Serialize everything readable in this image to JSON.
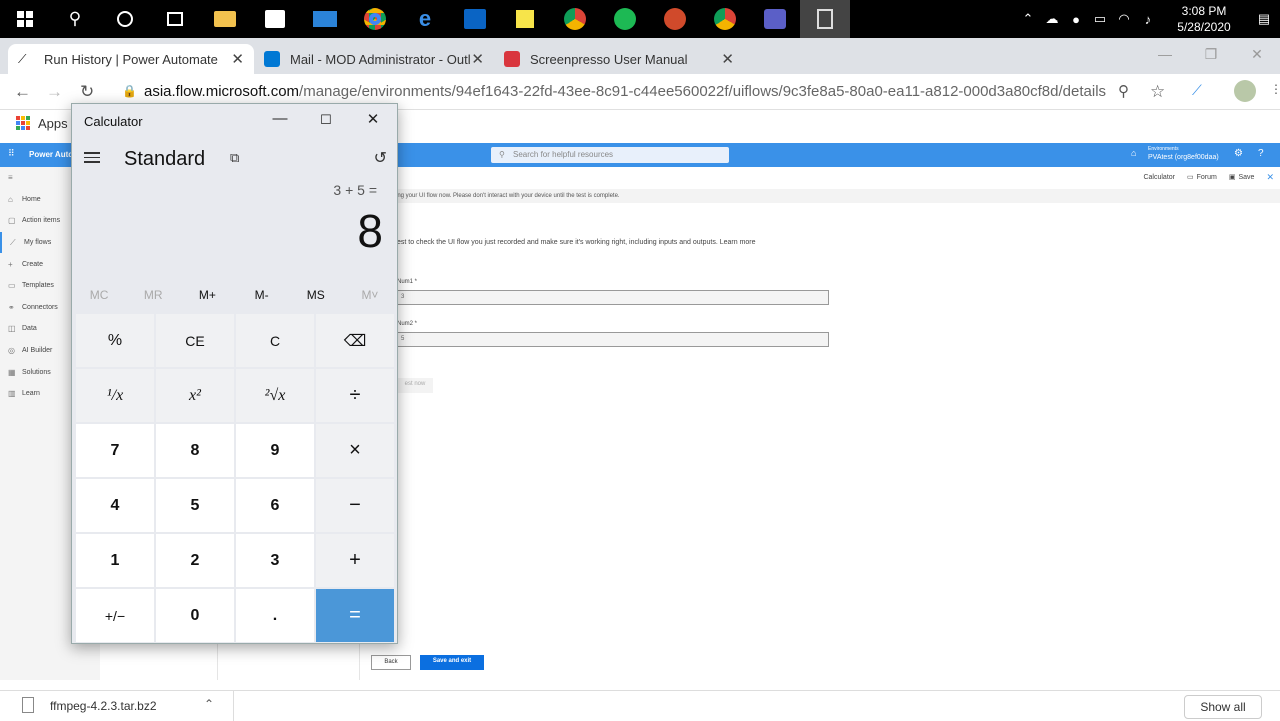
{
  "taskbar": {
    "icons": [
      "windows-start-icon",
      "search-icon",
      "cortana-icon",
      "task-view-icon",
      "file-explorer-icon",
      "store-icon",
      "mail-icon",
      "chrome-icon",
      "edge-icon",
      "outlook-icon",
      "sticky-notes-icon",
      "chrome-profile-icon",
      "spotify-icon",
      "powerpoint-icon",
      "chrome-alt-icon",
      "teams-icon",
      "calculator-icon"
    ],
    "time": "3:08 PM",
    "date": "5/28/2020"
  },
  "browser": {
    "tabs": [
      {
        "label": "Run History | Power Automate",
        "color": "#ffffff"
      },
      {
        "label": "Mail - MOD Administrator - Outl",
        "color": "#0078d4"
      },
      {
        "label": "Screenpresso User Manual",
        "color": "#d9363e"
      }
    ],
    "new_tab": "+",
    "url_host": "asia.flow.microsoft.com",
    "url_path": "/manage/environments/94ef1643-22fd-43ee-8c91-c44ee560022f/uiflows/9c3fe8a5-80a0-ea11-a812-000d3a80cf8d/details",
    "bookmarks_apps": "Apps"
  },
  "power_automate": {
    "brand": "Power Auto",
    "search_placeholder": "Search for helpful resources",
    "env_label": "Environments",
    "env_name": "PVAtest (org8ef00daa)",
    "nav": [
      "Home",
      "Action items",
      "My flows",
      "Create",
      "Templates",
      "Connectors",
      "Data",
      "AI Builder",
      "Solutions",
      "Learn"
    ],
    "cmd": {
      "calculator": "Calculator",
      "forum": "Forum",
      "save": "Save"
    },
    "banner": "ing your UI flow now. Please don't interact with your device until the test is complete.",
    "intro": "est to check the UI flow you just recorded and make sure it's working right, including inputs and outputs. Learn more",
    "num1_label": "Num1 *",
    "num1_value": "3",
    "num2_label": "Num2 *",
    "num2_value": "5",
    "test_now": "est now",
    "back": "Back",
    "save_exit": "Save and exit"
  },
  "download": {
    "file": "ffmpeg-4.2.3.tar.bz2",
    "show_all": "Show all"
  },
  "calculator": {
    "title": "Calculator",
    "mode": "Standard",
    "expression": "3 + 5 =",
    "result": "8",
    "memory": [
      "MC",
      "MR",
      "M+",
      "M-",
      "MS",
      "M˅"
    ],
    "keys": [
      [
        "%",
        "CE",
        "C",
        "⌫"
      ],
      [
        "¹/x",
        "x²",
        "²√x",
        "÷"
      ],
      [
        "7",
        "8",
        "9",
        "×"
      ],
      [
        "4",
        "5",
        "6",
        "−"
      ],
      [
        "1",
        "2",
        "3",
        "+"
      ],
      [
        "+/−",
        "0",
        ".",
        "="
      ]
    ]
  }
}
